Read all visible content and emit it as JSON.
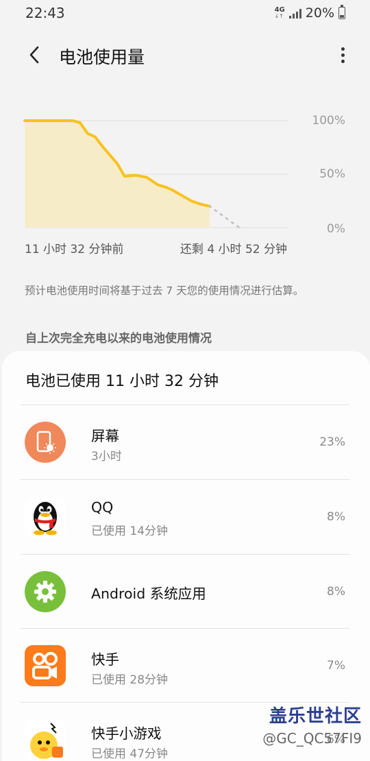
{
  "status_bar": {
    "time": "22:43",
    "network": "4G",
    "battery_percent": "20%"
  },
  "header": {
    "title": "电池使用量"
  },
  "chart": {
    "y_ticks": [
      "100%",
      "50%",
      "0%"
    ],
    "x_start_label": "11 小时 32 分钟前",
    "x_end_label": "还剩 4 小时 52 分钟",
    "accent_color": "#f7c21e",
    "fill_color": "#f7ecc8"
  },
  "chart_data": {
    "type": "line",
    "x": [
      0.0,
      0.12,
      0.26,
      0.3,
      0.34,
      0.38,
      0.42,
      0.46,
      0.5,
      0.54,
      0.6,
      0.66,
      0.72,
      0.76,
      0.8,
      0.85,
      0.9,
      0.95,
      1.0
    ],
    "values": [
      100,
      100,
      100,
      98,
      88,
      85,
      76,
      68,
      60,
      48,
      49,
      47,
      40,
      38,
      35,
      30,
      25,
      22,
      20
    ],
    "forecast_x": [
      1.0,
      1.16
    ],
    "forecast_values": [
      20,
      0
    ],
    "ylim": [
      0,
      100
    ]
  },
  "note": "预计电池使用时间将基于过去 7 天您的使用情况进行估算。",
  "section_header": "自上次完全充电以来的电池使用情况",
  "usage_card": {
    "title": "电池已使用 11 小时 32 分钟",
    "apps": [
      {
        "name": "屏幕",
        "detail": "3小时",
        "percent": "23%",
        "icon": "screen-brightness-icon",
        "color": "#f0885a"
      },
      {
        "name": "QQ",
        "detail": "已使用 14分钟",
        "percent": "8%",
        "icon": "qq-penguin-icon",
        "color": "#ffffff"
      },
      {
        "name": "Android 系统应用",
        "detail": "",
        "percent": "8%",
        "icon": "gear-icon",
        "color": "#78c03c"
      },
      {
        "name": "快手",
        "detail": "已使用 28分钟",
        "percent": "7%",
        "icon": "kuaishou-icon",
        "color": "#ff7a1a"
      },
      {
        "name": "快手小游戏",
        "detail": "已使用 47分钟",
        "percent": "6%",
        "icon": "kuaishou-games-icon",
        "color": "#ffd23c"
      }
    ]
  },
  "watermark": {
    "brand": "盖乐世社区",
    "user": "@GC_QC57FI9"
  }
}
